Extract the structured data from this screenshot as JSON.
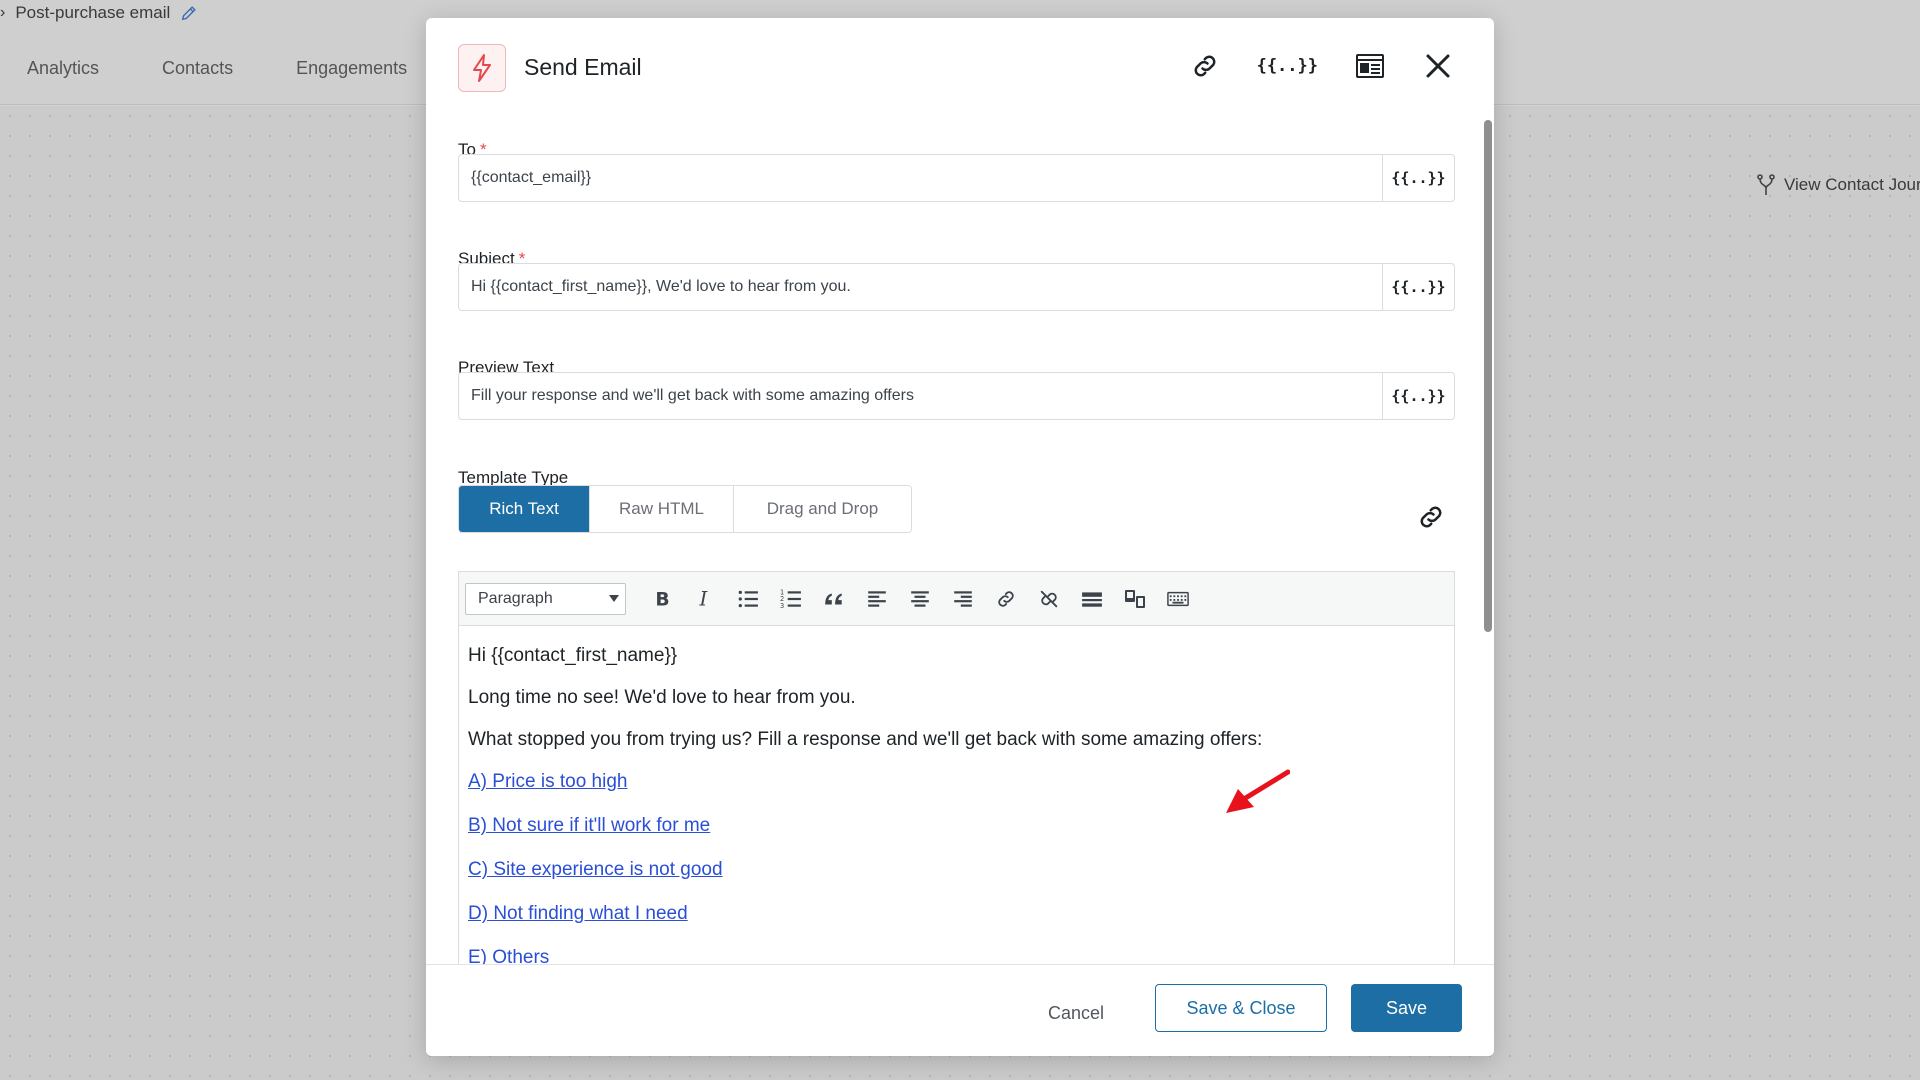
{
  "background": {
    "breadcrumb": "Post-purchase email",
    "tabs": [
      "Analytics",
      "Contacts",
      "Engagements"
    ],
    "view_contact_journey": "View Contact Jour"
  },
  "modal": {
    "title": "Send Email",
    "header_icons": [
      "link-icon",
      "merge-tag-icon",
      "template-preview-icon",
      "close-icon"
    ],
    "merge_tag_label": "{{..}}",
    "fields": {
      "to": {
        "label": "To",
        "required": "*",
        "value": "{{contact_email}}"
      },
      "subject": {
        "label": "Subject",
        "required": "*",
        "value": "Hi {{contact_first_name}}, We'd love to hear from you."
      },
      "preview": {
        "label": "Preview Text",
        "value": "Fill your response and we'll get back with some amazing offers"
      }
    },
    "template_type": {
      "label": "Template Type",
      "options": [
        "Rich Text",
        "Raw HTML",
        "Drag and Drop"
      ],
      "active": "Rich Text"
    },
    "editor": {
      "block_format": "Paragraph",
      "toolbar_icons": [
        "bold-icon",
        "italic-icon",
        "bullet-list-icon",
        "numbered-list-icon",
        "blockquote-icon",
        "align-left-icon",
        "align-center-icon",
        "align-right-icon",
        "insert-link-icon",
        "unlink-icon",
        "horizontal-rule-icon",
        "merge-tag-insert-icon",
        "keyboard-icon"
      ],
      "greeting": "Hi {{contact_first_name}}",
      "line1": "Long time no see! We'd love to hear from you.",
      "line2": "What stopped you from trying us? Fill a response and we'll get back with some amazing offers:",
      "links": [
        "A) Price is too high",
        "B) Not sure if it'll work for me",
        "C) Site experience is not good",
        "D) Not finding what I need",
        "E) Others"
      ]
    },
    "footer": {
      "cancel": "Cancel",
      "save_close": "Save & Close",
      "save": "Save"
    }
  },
  "colors": {
    "primary": "#1d6ea5",
    "link": "#2a4fd6",
    "required": "#e5484d",
    "annotation_arrow": "#e8121c"
  }
}
